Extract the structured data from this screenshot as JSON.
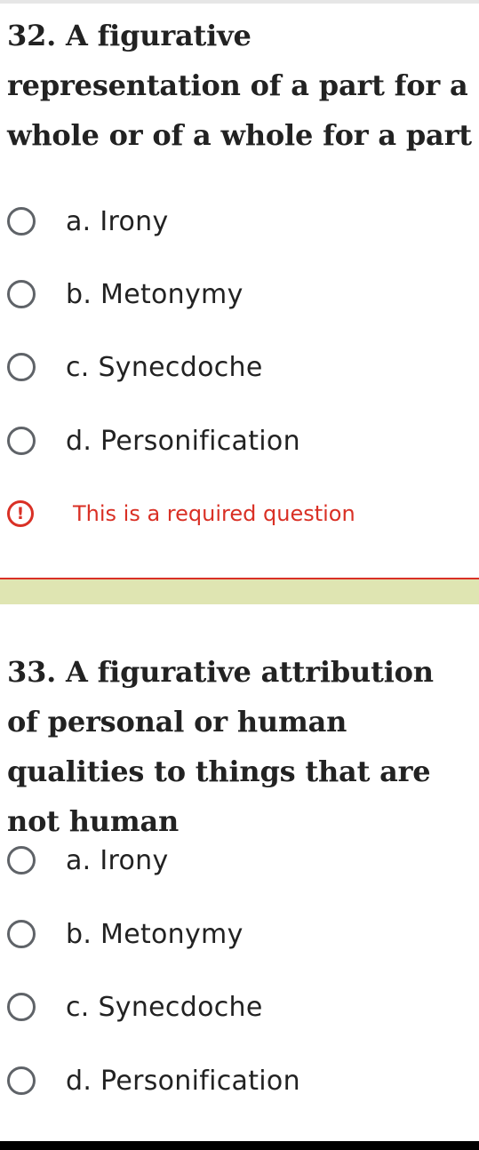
{
  "questions": [
    {
      "title": "32. A figurative representation of a part for a whole or of a whole for a part",
      "options": [
        "a. Irony",
        "b. Metonymy",
        "c. Synecdoche",
        "d. Personification"
      ],
      "required_message": "This is a required question"
    },
    {
      "title": "33. A figurative attribution of personal or human qualities to things that are not human",
      "options": [
        "a. Irony",
        "b. Metonymy",
        "c. Synecdoche",
        "d. Personification"
      ]
    }
  ],
  "colors": {
    "error": "#d93025",
    "band": "#dfe5b2",
    "radio_border": "#5f6368",
    "text": "#222222"
  },
  "icons": {
    "radio": "radio-unchecked-icon",
    "warning": "exclamation-circle-icon"
  }
}
